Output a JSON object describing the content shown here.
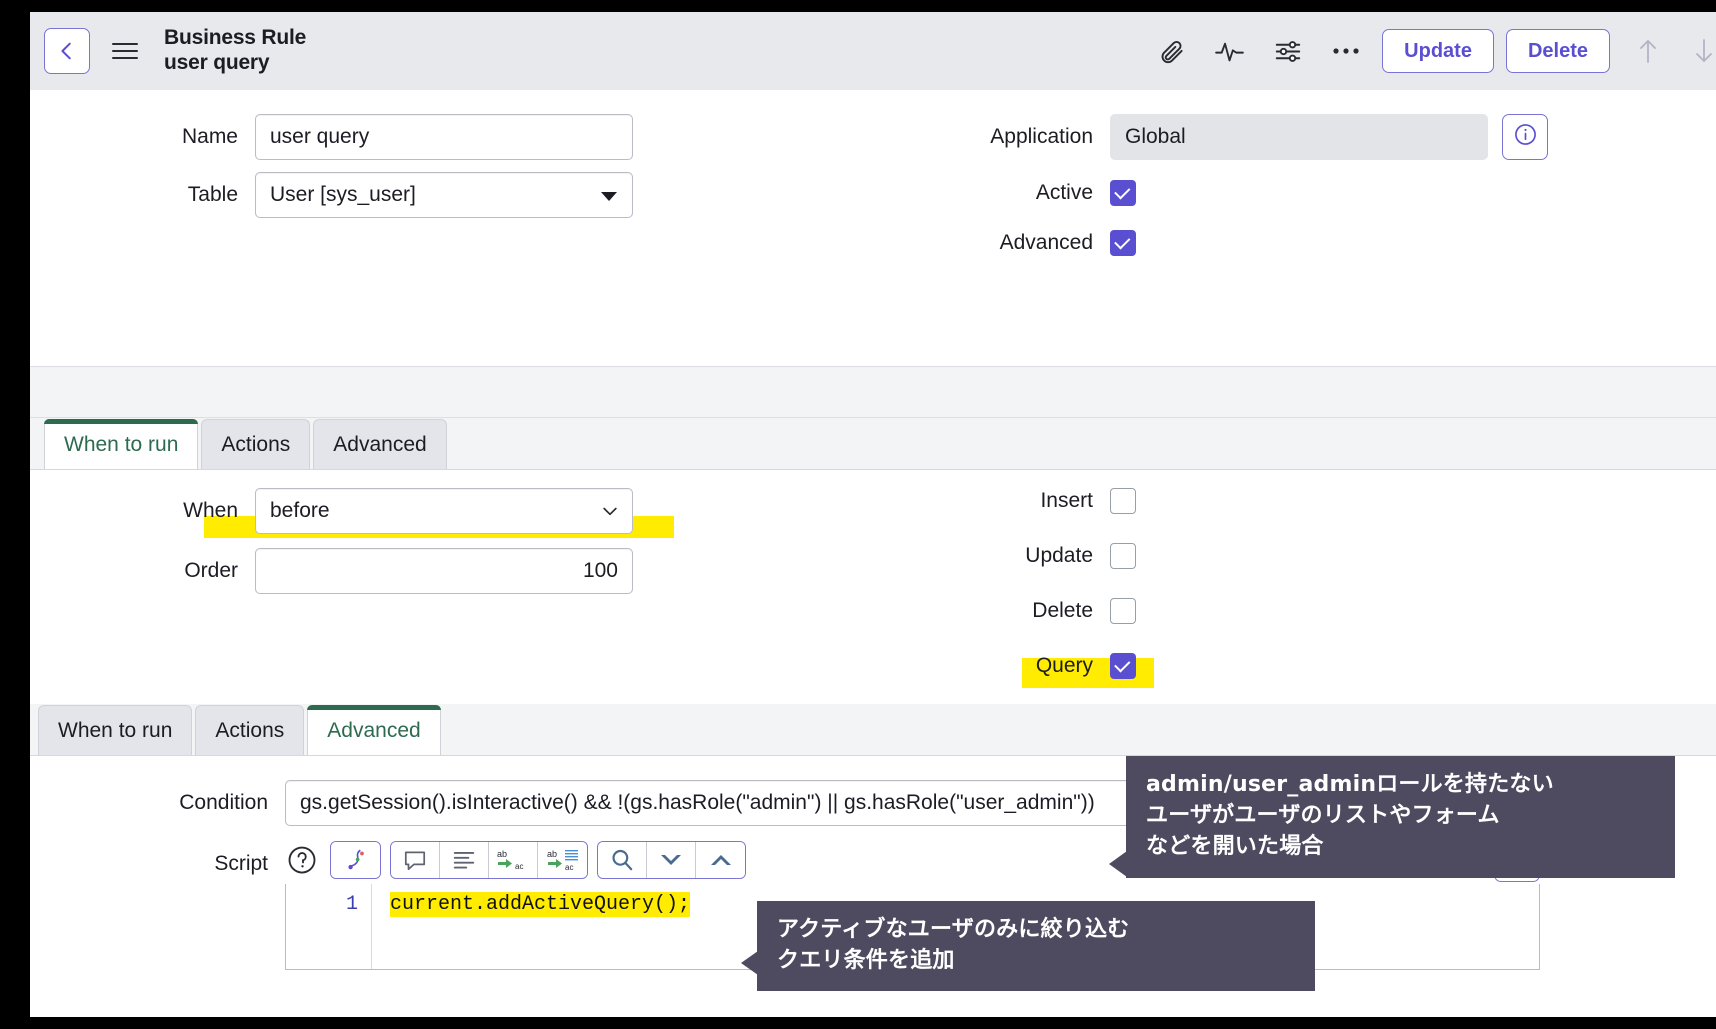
{
  "header": {
    "back_icon": "chevron-left-icon",
    "menu_icon": "hamburger-menu-icon",
    "record_type": "Business Rule",
    "record_name": "user query",
    "icons": [
      {
        "name": "attachment-icon",
        "label": "Attachments"
      },
      {
        "name": "activity-icon",
        "label": "Activity"
      },
      {
        "name": "personalize-sliders-icon",
        "label": "Personalize Form"
      },
      {
        "name": "more-actions-icon",
        "label": "More actions"
      }
    ],
    "update_label": "Update",
    "delete_label": "Delete",
    "nav_up_icon": "arrow-up-icon",
    "nav_down_icon": "arrow-down-icon"
  },
  "form": {
    "left": {
      "name_label": "Name",
      "name_value": "user query",
      "table_label": "Table",
      "table_value": "User [sys_user]"
    },
    "right": {
      "application_label": "Application",
      "application_value": "Global",
      "info_icon": "info-circle-icon",
      "active_label": "Active",
      "active_checked": "true",
      "advanced_label": "Advanced",
      "advanced_checked": "true"
    }
  },
  "panel_when": {
    "tabs": [
      {
        "label": "When to run",
        "active": "true"
      },
      {
        "label": "Actions",
        "active": "false"
      },
      {
        "label": "Advanced",
        "active": "false"
      }
    ],
    "when_label": "When",
    "when_value": "before",
    "order_label": "Order",
    "order_value": "100",
    "checks": [
      {
        "label": "Insert",
        "checked": "false",
        "highlight": "false"
      },
      {
        "label": "Update",
        "checked": "false",
        "highlight": "false"
      },
      {
        "label": "Delete",
        "checked": "false",
        "highlight": "false"
      },
      {
        "label": "Query",
        "checked": "true",
        "highlight": "true"
      }
    ]
  },
  "panel_advanced": {
    "tabs": [
      {
        "label": "When to run",
        "active": "false"
      },
      {
        "label": "Actions",
        "active": "false"
      },
      {
        "label": "Advanced",
        "active": "true"
      }
    ],
    "condition_label": "Condition",
    "condition_value": "gs.getSession().isInteractive() && !(gs.hasRole(\"admin\") || gs.hasRole(\"user_admin\"))",
    "script_label": "Script",
    "script_toolbar": [
      {
        "name": "help-icon"
      },
      {
        "name": "script-syntax-icon"
      },
      {
        "name": "comment-icon"
      },
      {
        "name": "format-code-icon"
      },
      {
        "name": "replace-icon"
      },
      {
        "name": "replace-all-icon"
      },
      {
        "name": "search-icon"
      },
      {
        "name": "find-next-icon"
      },
      {
        "name": "find-previous-icon"
      }
    ],
    "expand_icon": "chevron-right-icon",
    "code_lines": [
      {
        "number": "1",
        "text": "current.addActiveQuery();",
        "highlight": "true"
      }
    ]
  },
  "annotations": [
    {
      "name": "condition-callout",
      "lines": [
        "admin/user_adminロールを持たない",
        "ユーザがユーザのリストやフォーム",
        "などを開いた場合"
      ]
    },
    {
      "name": "script-callout",
      "lines": [
        "アクティブなユーザのみに絞り込む",
        "クエリ条件を追加"
      ]
    }
  ],
  "colors": {
    "accent_purple": "#5a4fd1",
    "tab_active_green": "#2d6b4f",
    "highlight_yellow": "#ffec00",
    "callout_bg": "#4e4b60"
  }
}
